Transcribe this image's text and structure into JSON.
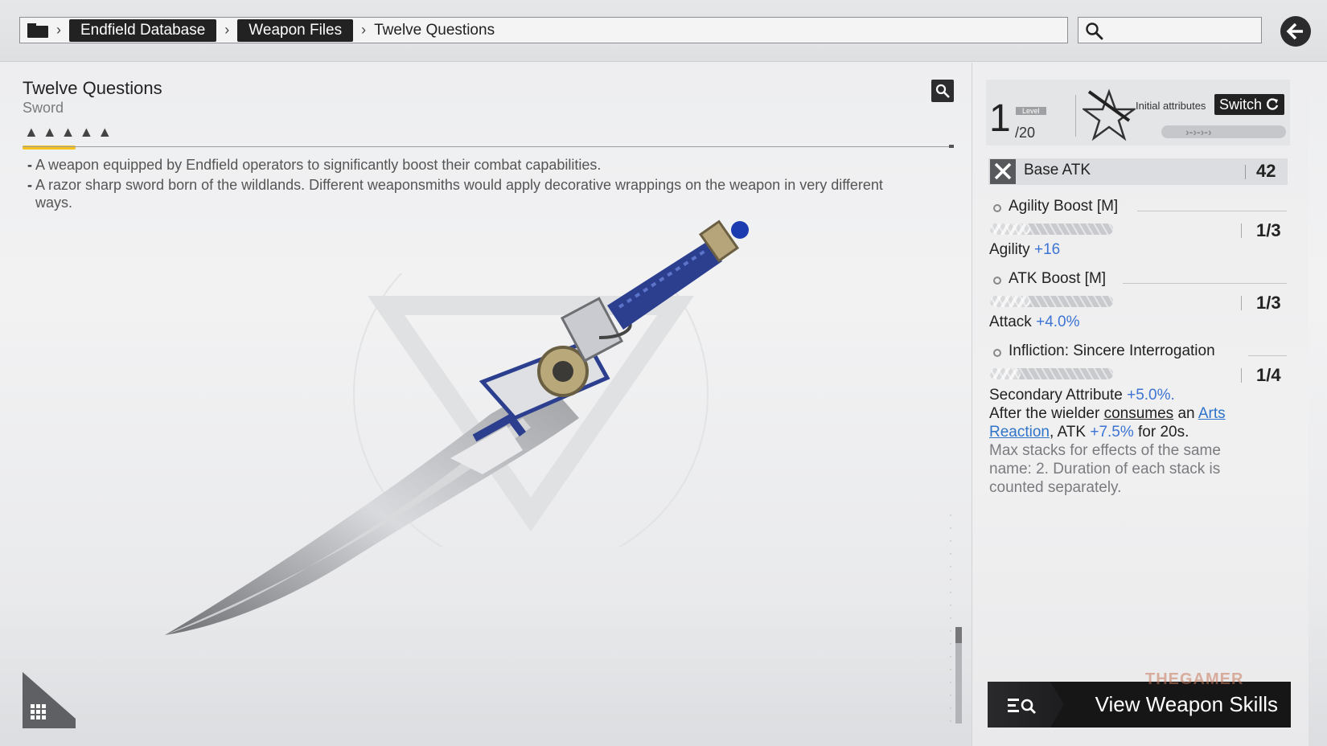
{
  "breadcrumb": {
    "items": [
      "Endfield Database",
      "Weapon Files"
    ],
    "current": "Twelve Questions"
  },
  "search": {
    "placeholder": ""
  },
  "weapon": {
    "name": "Twelve Questions",
    "type": "Sword",
    "rarity_stars": 5,
    "descriptions": [
      "A weapon equipped by Endfield operators to significantly boost their combat capabilities.",
      "A razor sharp sword born of the wildlands. Different weaponsmiths would apply decorative wrappings on the weapon in very different ways."
    ]
  },
  "level": {
    "current": "1",
    "tag": "Level",
    "max": "/20"
  },
  "attributes_header": {
    "label": "Initial attributes",
    "switch_label": "Switch"
  },
  "base_atk": {
    "label": "Base ATK",
    "value": "42"
  },
  "skills": [
    {
      "name": "Agility Boost [M]",
      "count": "1/3",
      "progress": 0.33,
      "effect_label": "Agility",
      "effect_value": "+16"
    },
    {
      "name": "ATK Boost [M]",
      "count": "1/3",
      "progress": 0.33,
      "effect_label": "Attack",
      "effect_value": "+4.0%"
    },
    {
      "name": "Infliction: Sincere Interrogation",
      "count": "1/4",
      "progress": 0.25,
      "effect_label": "Secondary Attribute",
      "effect_value": "+5.0%.",
      "line2": {
        "prefix": "After the wielder ",
        "verb": "consumes",
        "mid": " an ",
        "link": "Arts Reaction",
        "after_link": ", ATK ",
        "value": "+7.5%",
        "suffix": " for 20s."
      },
      "note": "Max stacks for effects of the same name: 2. Duration of each stack is counted separately."
    }
  ],
  "view_skills": {
    "label": "View Weapon Skills"
  },
  "watermark": "THEGAMER",
  "colors": {
    "accent_blue": "#3d74d4",
    "rarity_yellow": "#f4c21a",
    "dark": "#222222"
  }
}
